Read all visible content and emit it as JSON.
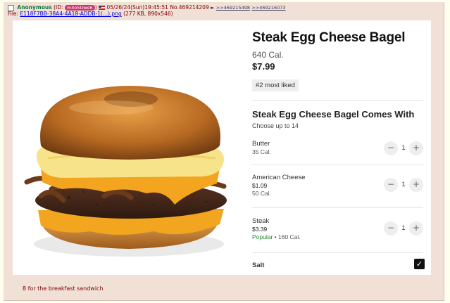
{
  "post": {
    "name": "Anonymous",
    "id_prefix": "(ID: ",
    "id": "m4o5Uwe6",
    "id_suffix": ")",
    "datetime": "05/26/24(Sun)19:45:51",
    "post_no": "No.469214209",
    "arrow": "►",
    "quotes": [
      ">>469215498",
      ">>469216073"
    ],
    "file_prefix": "File: ",
    "file_name": "E118F7BB-38A4-4A18-ADDB-1(...).png",
    "file_info": " (277 KB, 890x546)",
    "comment": "8 for the breakfast sandwich"
  },
  "product": {
    "title": "Steak Egg Cheese Bagel",
    "calories": "640 Cal.",
    "price": "$7.99",
    "badge": "#2 most liked",
    "section_title": "Steak Egg Cheese Bagel Comes With",
    "section_sub": "Choose up to 14",
    "options": [
      {
        "name": "Butter",
        "price": "",
        "popular": "",
        "cal": "35 Cal.",
        "qty": "1"
      },
      {
        "name": "American Cheese",
        "price": "$1.09",
        "popular": "",
        "cal": "50 Cal.",
        "qty": "1"
      },
      {
        "name": "Steak",
        "price": "$3.39",
        "popular": "Popular",
        "cal": " • 160 Cal.",
        "qty": "1"
      }
    ],
    "minus": "−",
    "plus": "+",
    "salt_label": "Salt",
    "check": "✓"
  }
}
